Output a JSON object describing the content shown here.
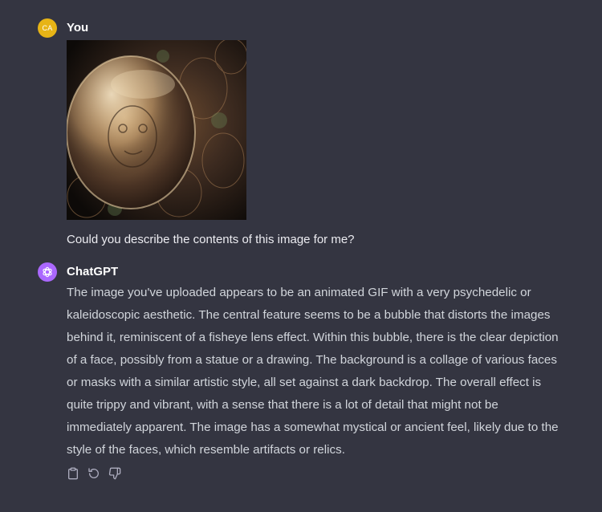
{
  "user": {
    "avatar_initials": "CA",
    "name": "You",
    "message": "Could you describe the contents of this image for me?"
  },
  "assistant": {
    "name": "ChatGPT",
    "message": "The image you've uploaded appears to be an animated GIF with a very psychedelic or kaleidoscopic aesthetic. The central feature seems to be a bubble that distorts the images behind it, reminiscent of a fisheye lens effect. Within this bubble, there is the clear depiction of a face, possibly from a statue or a drawing. The background is a collage of various faces or masks with a similar artistic style, all set against a dark backdrop. The overall effect is quite trippy and vibrant, with a sense that there is a lot of detail that might not be immediately apparent. The image has a somewhat mystical or ancient feel, likely due to the style of the faces, which resemble artifacts or relics."
  },
  "actions": [
    "copy-icon",
    "regenerate-icon",
    "thumbs-down-icon"
  ],
  "colors": {
    "background": "#343541",
    "user_avatar": "#e7b416",
    "assistant_avatar": "#ab68ff",
    "text": "#d1d5db"
  }
}
